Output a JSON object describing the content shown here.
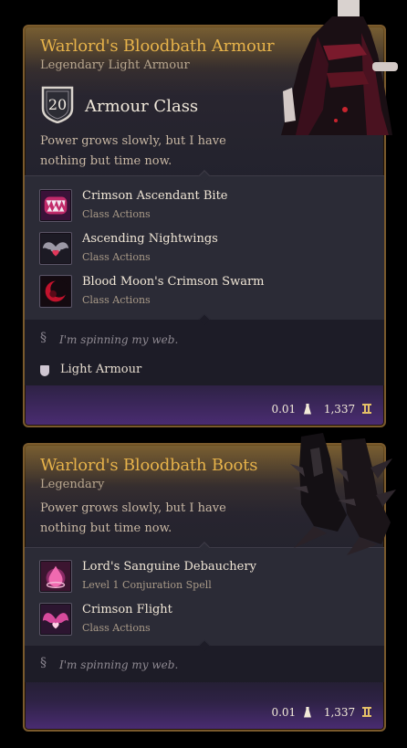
{
  "armour": {
    "title": "Warlord's Bloodbath Armour",
    "subtitle": "Legendary Light Armour",
    "armour_class_value": "20",
    "armour_class_label": "Armour Class",
    "description": "Power grows slowly, but I have nothing but time now.",
    "actions": [
      {
        "name": "Crimson Ascendant Bite",
        "type": "Class Actions",
        "icon": "fangs-icon"
      },
      {
        "name": "Ascending Nightwings",
        "type": "Class Actions",
        "icon": "bat-wings-icon"
      },
      {
        "name": "Blood Moon's Crimson Swarm",
        "type": "Class Actions",
        "icon": "blood-moon-icon"
      }
    ],
    "flavor": "I'm spinning my web.",
    "proficiency": "Light Armour",
    "weight": "0.01",
    "value": "1,337"
  },
  "boots": {
    "title": "Warlord's Bloodbath Boots",
    "subtitle": "Legendary",
    "description": "Power grows slowly, but I have nothing but time now.",
    "actions": [
      {
        "name": "Lord's Sanguine Debauchery",
        "type": "Level 1 Conjuration Spell",
        "icon": "blood-drop-icon"
      },
      {
        "name": "Crimson Flight",
        "type": "Class Actions",
        "icon": "crimson-wings-icon"
      }
    ],
    "flavor": "I'm spinning my web.",
    "weight": "0.01",
    "value": "1,337"
  },
  "colors": {
    "title_gold": "#e6b24a",
    "border_bronze": "#7a5a2c",
    "footer_purple": "#4a2c72"
  }
}
